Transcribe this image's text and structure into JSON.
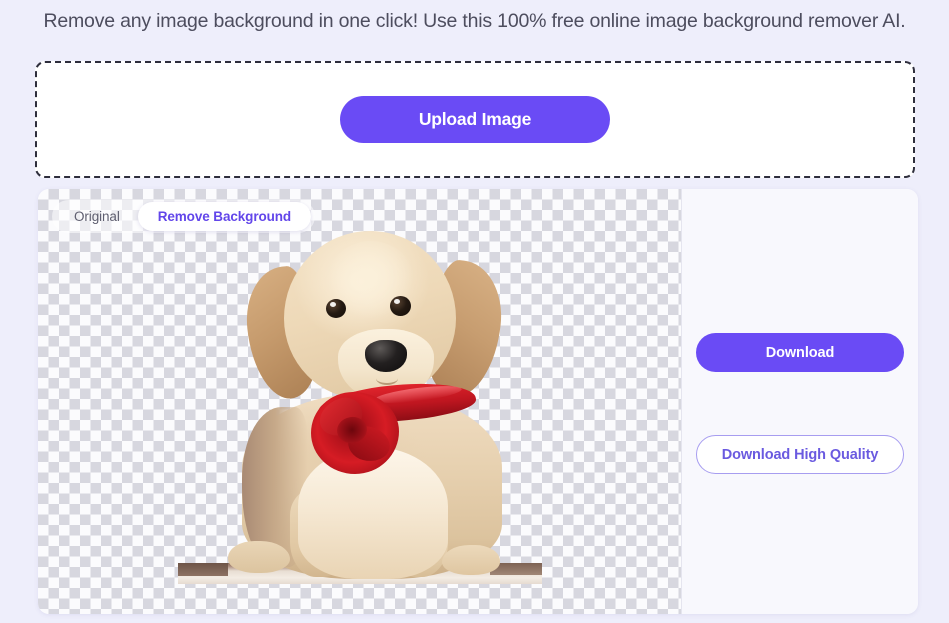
{
  "page": {
    "heading": "Remove any image background in one click! Use this 100% free online image background remover AI.",
    "background_color": "#eeeefb",
    "accent_color": "#6a4bf5"
  },
  "upload": {
    "button_label": "Upload Image",
    "zone_border_style": "dashed",
    "zone_border_color": "#2e2e3c"
  },
  "result": {
    "tabs": [
      {
        "label": "Original",
        "active": false
      },
      {
        "label": "Remove Background",
        "active": true
      }
    ],
    "preview": {
      "transparency_checkerboard": true,
      "checker_light_color": "#fbfbfd",
      "checker_dark_color": "#d7d7df",
      "subject": "golden-retriever-puppy-with-red-rose-ribbon"
    },
    "actions": {
      "download_label": "Download",
      "download_high_quality_label": "Download High Quality",
      "download_color": "#6a4bf5",
      "download_hq_text_color": "#6a5ae0",
      "download_hq_border_color": "#a79df0"
    }
  }
}
